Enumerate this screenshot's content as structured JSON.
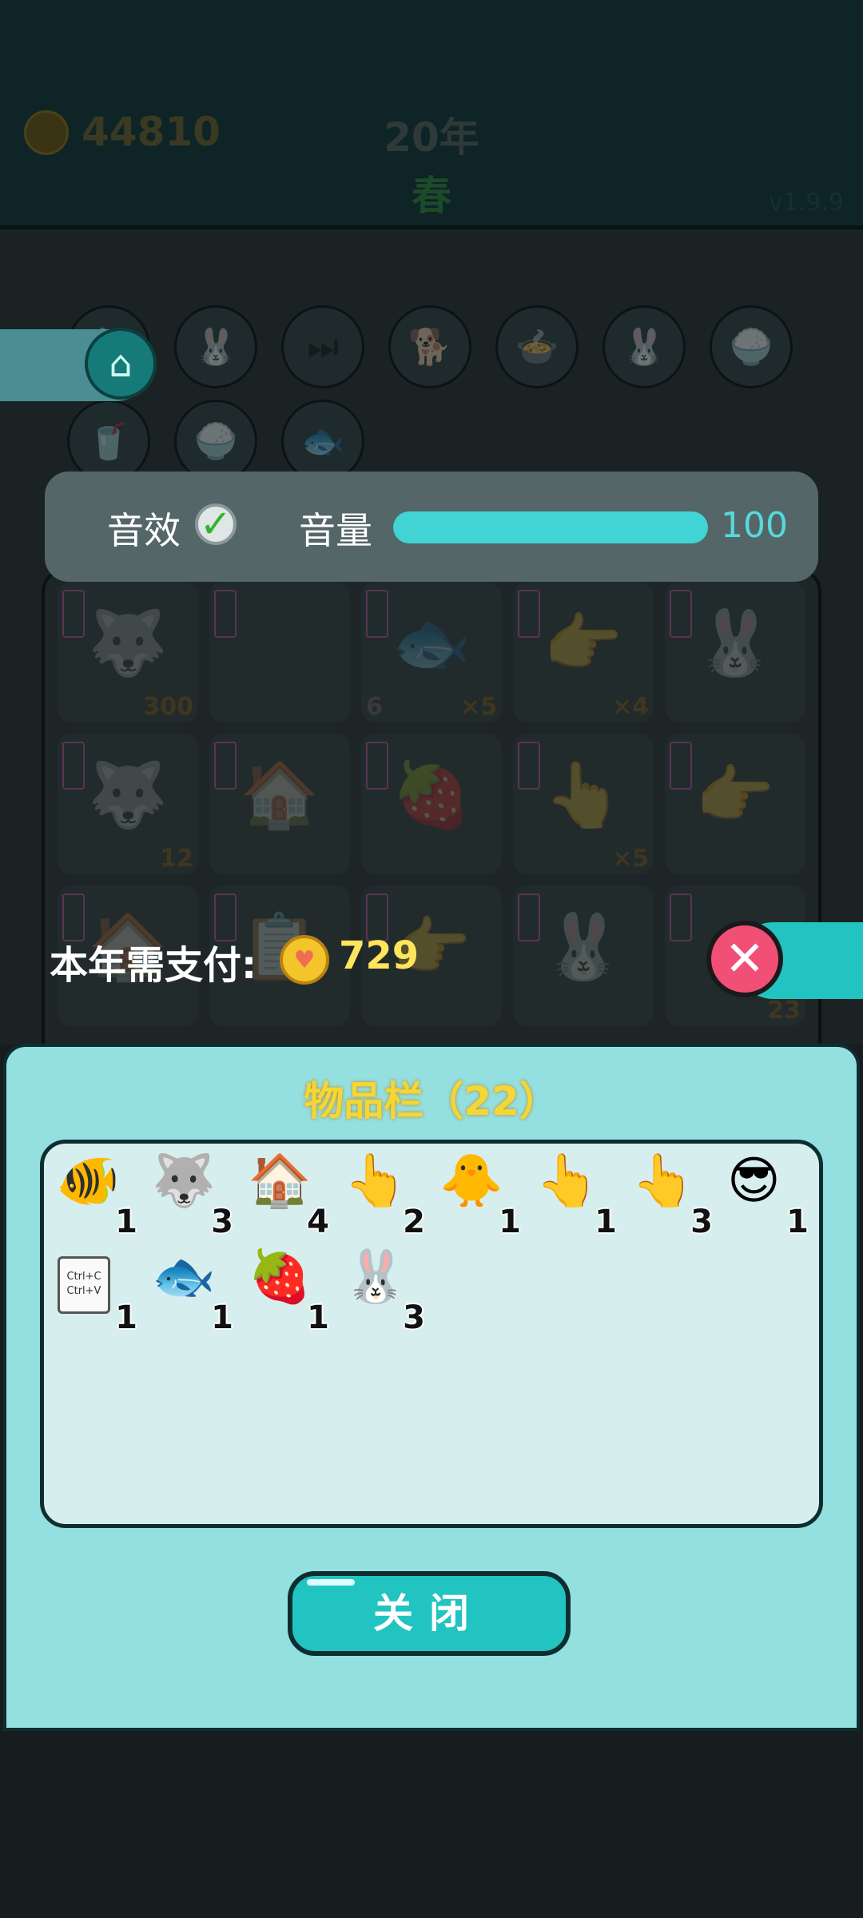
{
  "header": {
    "coins": "44810",
    "year": "20年",
    "season": "春",
    "version": "v1.9.9"
  },
  "shop": {
    "icons": [
      "rabbit-icon",
      "rabbit-coin-icon",
      "skip-icon",
      "dog-coin-icon",
      "pot-icon",
      "rabbit-pink-icon",
      "rice-bowl-icon",
      "drink-icon",
      "rice-bowl-coin-icon",
      "fish-bowl-icon"
    ]
  },
  "settings": {
    "sfx_label": "音效",
    "volume_label": "音量",
    "volume_value": "100",
    "volume_fraction": 1.0
  },
  "grid": {
    "cells": [
      {
        "glyph": "🐺",
        "count": "300"
      },
      {
        "glyph": "",
        "count": ""
      },
      {
        "glyph": "🐟",
        "count_left": "6",
        "count": "×5"
      },
      {
        "glyph": "👉",
        "count": "×4"
      },
      {
        "glyph": "🐰",
        "count": ""
      },
      {
        "glyph": "🐺",
        "count": "12"
      },
      {
        "glyph": "🏠",
        "count": ""
      },
      {
        "glyph": "🍓",
        "count": ""
      },
      {
        "glyph": "👆",
        "count": "×5"
      },
      {
        "glyph": "👉",
        "count": ""
      },
      {
        "glyph": "🏠",
        "count": ""
      },
      {
        "glyph": "📋",
        "count": ""
      },
      {
        "glyph": "👉",
        "count": ""
      },
      {
        "glyph": "🐰",
        "count": ""
      },
      {
        "glyph": "",
        "count": "23"
      }
    ]
  },
  "pay": {
    "label": "本年需支付:",
    "amount": "729"
  },
  "inventory": {
    "title": "物品栏（22）",
    "items": [
      {
        "name": "koi-fish",
        "glyph": "🐠",
        "count": "1"
      },
      {
        "name": "husky-king",
        "glyph": "🐺",
        "count": "3"
      },
      {
        "name": "pet-house",
        "glyph": "🏠",
        "count": "4"
      },
      {
        "name": "brown-finger",
        "glyph": "👆",
        "count": "2"
      },
      {
        "name": "chick",
        "glyph": "🐥",
        "count": "1"
      },
      {
        "name": "yellow-finger",
        "glyph": "👆",
        "count": "1"
      },
      {
        "name": "gray-finger",
        "glyph": "👆",
        "count": "3"
      },
      {
        "name": "green-hair-man",
        "glyph": "😎",
        "count": "1"
      },
      {
        "name": "copy-paste",
        "glyph": "",
        "count": "1",
        "clip_text": "Ctrl+C\nCtrl+V"
      },
      {
        "name": "fish",
        "glyph": "🐟",
        "count": "1"
      },
      {
        "name": "lychee",
        "glyph": "🍓",
        "count": "1"
      },
      {
        "name": "rabbit",
        "glyph": "🐰",
        "count": "3"
      }
    ],
    "close_label": "关闭"
  }
}
